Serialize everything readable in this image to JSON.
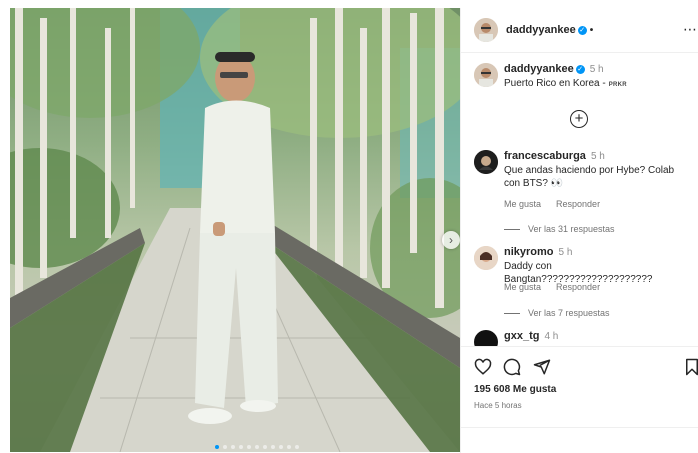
{
  "post": {
    "author": "daddyyankee",
    "verified": true,
    "time": "5 h",
    "caption": "Puerto Rico en Korea -",
    "caption_tag": "PRKR",
    "carousel": {
      "slides": 11,
      "active_index": 0
    }
  },
  "header": {
    "username": "daddyyankee",
    "follow_dot": "•",
    "more_icon": "more-options-icon"
  },
  "comments": [
    {
      "username": "francescaburga",
      "time": "5 h",
      "text": "Que andas haciendo por Hybe? Colab con BTS? 👀",
      "like_label": "Me gusta",
      "reply_label": "Responder",
      "replies_label": "Ver las 31 respuestas"
    },
    {
      "username": "nikyromo",
      "time": "5 h",
      "text": "Daddy con Bangtan????????????????????",
      "like_label": "Me gusta",
      "reply_label": "Responder",
      "replies_label": "Ver las 7 respuestas"
    },
    {
      "username": "gxx_tg",
      "time": "4 h"
    }
  ],
  "actions": {
    "likes": "195 608 Me gusta",
    "posted_ago": "Hace 5 horas"
  },
  "colors": {
    "accent": "#0095f6",
    "text": "#262626",
    "muted": "#737373"
  }
}
